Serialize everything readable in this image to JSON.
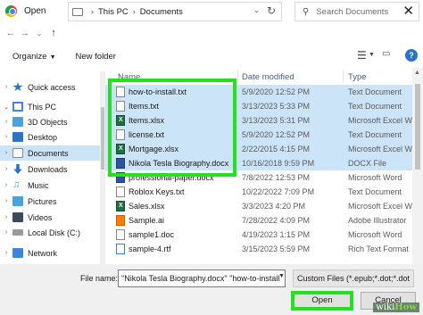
{
  "window": {
    "title": "Open"
  },
  "address": {
    "crumbs": [
      "This PC",
      "Documents"
    ]
  },
  "search": {
    "placeholder": "Search Documents"
  },
  "toolbar": {
    "organize_label": "Organize",
    "new_folder_label": "New folder"
  },
  "sidebar": {
    "items": [
      {
        "label": "Quick access",
        "icon": "star-icon",
        "color": "#2a73c8"
      },
      {
        "label": "This PC",
        "icon": "computer-icon",
        "color": "#3d86d6"
      },
      {
        "label": "3D Objects",
        "icon": "cube-icon",
        "color": "#4aa3df"
      },
      {
        "label": "Desktop",
        "icon": "desktop-icon",
        "color": "#2a73c8"
      },
      {
        "label": "Documents",
        "icon": "documents-icon",
        "color": "#8a8a8a",
        "selected": true
      },
      {
        "label": "Downloads",
        "icon": "download-icon",
        "color": "#2a73c8"
      },
      {
        "label": "Music",
        "icon": "music-icon",
        "color": "#4aa3df"
      },
      {
        "label": "Pictures",
        "icon": "pictures-icon",
        "color": "#4aa3df"
      },
      {
        "label": "Videos",
        "icon": "videos-icon",
        "color": "#4aa3df"
      },
      {
        "label": "Local Disk (C:)",
        "icon": "disk-icon",
        "color": "#666666"
      },
      {
        "label": "Network",
        "icon": "network-icon",
        "color": "#3d86d6"
      }
    ]
  },
  "columns": {
    "name": "Name",
    "date": "Date modified",
    "type": "Type"
  },
  "files": [
    {
      "name": "how-to-install.txt",
      "date": "5/9/2020 12:52 PM",
      "type": "Text Document",
      "icon": "txt",
      "selected": true
    },
    {
      "name": "Items.txt",
      "date": "3/13/2023 5:33 PM",
      "type": "Text Document",
      "icon": "txt",
      "selected": true
    },
    {
      "name": "Items.xlsx",
      "date": "3/13/2023 5:31 PM",
      "type": "Microsoft Excel W",
      "icon": "xlsx",
      "selected": true
    },
    {
      "name": "license.txt",
      "date": "5/9/2020 12:52 PM",
      "type": "Text Document",
      "icon": "txt",
      "selected": true
    },
    {
      "name": "Mortgage.xlsx",
      "date": "2/22/2015 4:15 PM",
      "type": "Microsoft Excel W",
      "icon": "xlsx",
      "selected": true
    },
    {
      "name": "Nikola Tesla Biography.docx",
      "date": "10/16/2018 9:59 PM",
      "type": "DOCX File",
      "icon": "docx",
      "selected": true
    },
    {
      "name": "professional-paper.docx",
      "date": "7/8/2022 12:53 PM",
      "type": "Microsoft Word",
      "icon": "docx",
      "selected": false
    },
    {
      "name": "Roblox Keys.txt",
      "date": "10/22/2022 7:09 PM",
      "type": "Text Document",
      "icon": "txt",
      "selected": false
    },
    {
      "name": "Sales.xlsx",
      "date": "3/3/2023 4:20 PM",
      "type": "Microsoft Excel W",
      "icon": "xlsx",
      "selected": false
    },
    {
      "name": "Sample.ai",
      "date": "7/28/2022 4:09 PM",
      "type": "Adobe Illustrator",
      "icon": "ai",
      "selected": false
    },
    {
      "name": "sample1.doc",
      "date": "4/19/2023 1:15 PM",
      "type": "Microsoft Word",
      "icon": "doc",
      "selected": false
    },
    {
      "name": "sample-4.rtf",
      "date": "3/15/2023 5:59 PM",
      "type": "Rich Text Format",
      "icon": "rtf",
      "selected": false
    }
  ],
  "bottom": {
    "file_name_label": "File name:",
    "file_name_value": "\"Nikola Tesla Biography.docx\" \"how-to-install",
    "filter_value": "Custom Files (*.epub;*.dot;*.dot",
    "open_label": "Open",
    "cancel_label": "Cancel"
  },
  "watermark": {
    "brand": "wikiHow",
    "highlight_color": "#21e121"
  }
}
